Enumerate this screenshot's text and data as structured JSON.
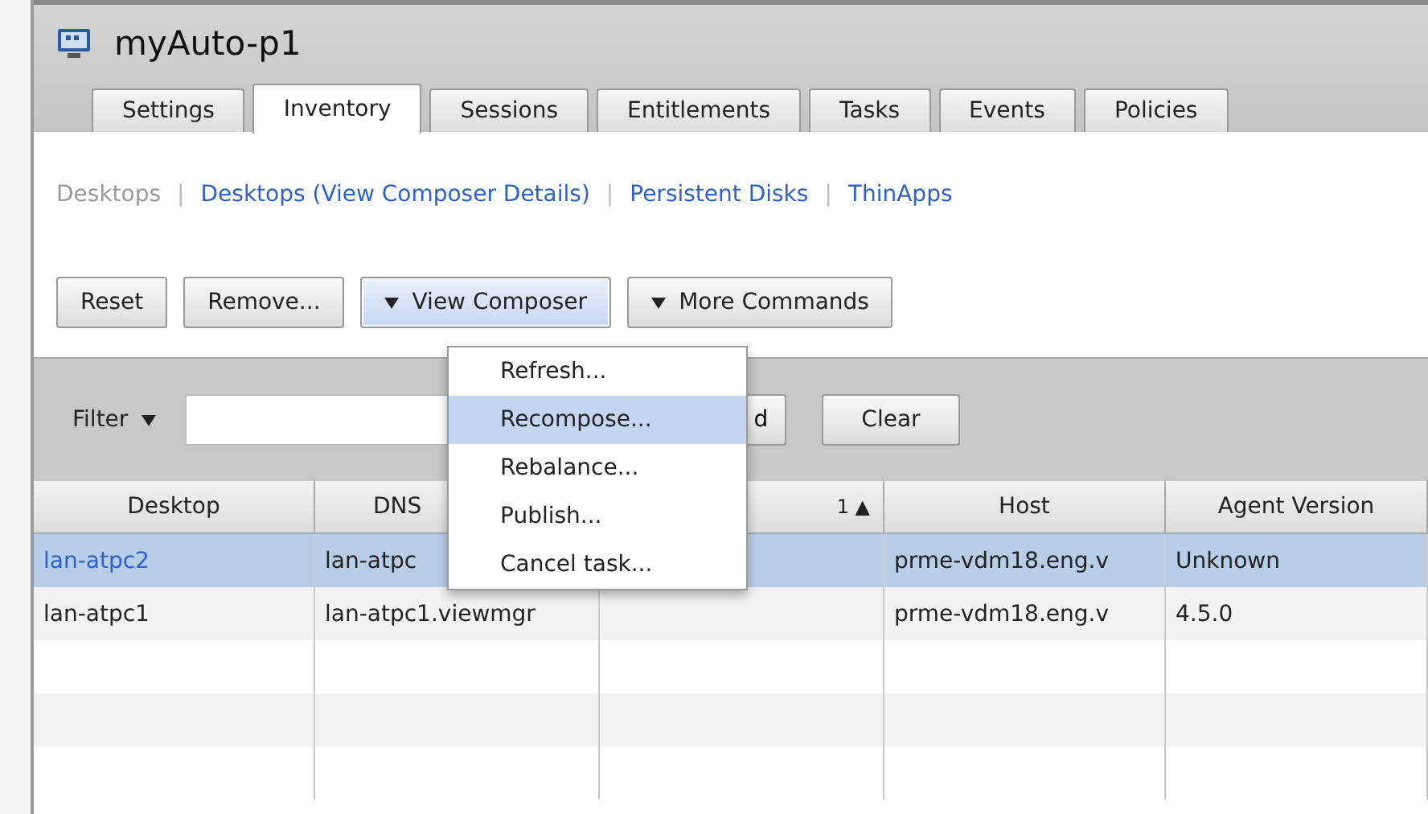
{
  "window": {
    "title": "myAuto-p1"
  },
  "tabs": [
    {
      "label": "Settings",
      "selected": false
    },
    {
      "label": "Inventory",
      "selected": true
    },
    {
      "label": "Sessions",
      "selected": false
    },
    {
      "label": "Entitlements",
      "selected": false
    },
    {
      "label": "Tasks",
      "selected": false
    },
    {
      "label": "Events",
      "selected": false
    },
    {
      "label": "Policies",
      "selected": false
    }
  ],
  "subnav": [
    {
      "label": "Desktops",
      "selected": true
    },
    {
      "separator": "|",
      "label": "Desktops (View Composer Details)",
      "selected": false
    },
    {
      "separator": "|",
      "label": "Persistent Disks",
      "selected": false
    },
    {
      "separator": "|",
      "label": "ThinApps",
      "selected": false
    }
  ],
  "commands": [
    {
      "label": "Reset",
      "kind": "plain",
      "active": false
    },
    {
      "label": "Remove...",
      "kind": "plain",
      "active": false
    },
    {
      "label": "View Composer",
      "kind": "dropdown",
      "active": true
    },
    {
      "label": "More Commands",
      "kind": "dropdown",
      "active": false
    }
  ],
  "filter": {
    "label": "Filter",
    "find_button": "d",
    "clear_button": "Clear"
  },
  "menu": [
    {
      "label": "Refresh...",
      "selected": false
    },
    {
      "label": "Recompose...",
      "selected": true
    },
    {
      "label": "Rebalance...",
      "selected": false
    },
    {
      "label": "Publish...",
      "selected": false
    },
    {
      "label": "Cancel task...",
      "selected": false
    }
  ],
  "table": {
    "columns": [
      {
        "label": "Desktop"
      },
      {
        "label": "DNS"
      },
      {
        "sort": "1 ▲"
      },
      {
        "label": "Host"
      },
      {
        "label": "Agent Version"
      }
    ],
    "rows": [
      {
        "selected": true,
        "desktop": "lan-atpc2",
        "dns": "lan-atpc",
        "host": "prme-vdm18.eng.v",
        "agent_version": "Unknown"
      },
      {
        "selected": false,
        "desktop": "lan-atpc1",
        "dns": "lan-atpc1.viewmgr",
        "host": "prme-vdm18.eng.v",
        "agent_version": "4.5.0"
      }
    ]
  }
}
